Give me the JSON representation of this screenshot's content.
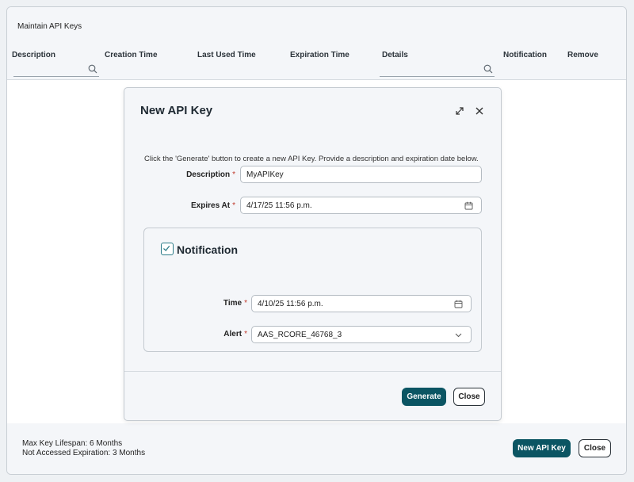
{
  "page": {
    "title": "Maintain API Keys",
    "columns": [
      "Description",
      "Creation Time",
      "Last Used Time",
      "Expiration Time",
      "Details",
      "Notification",
      "Remove"
    ]
  },
  "footer": {
    "max_lifespan": "Max Key Lifespan: 6 Months",
    "not_accessed": "Not Accessed Expiration: 3 Months",
    "new_key_button": "New API Key",
    "close_button": "Close"
  },
  "modal": {
    "title": "New API Key",
    "description_text": "Click the 'Generate' button to create a new API Key. Provide a description and expiration date below.",
    "fields": {
      "description": {
        "label": "Description",
        "required_mark": "*",
        "value": "MyAPIKey"
      },
      "expires_at": {
        "label": "Expires At",
        "required_mark": "*",
        "value": "4/17/25 11:56 p.m."
      }
    },
    "notification": {
      "label": "Notification",
      "checked": true,
      "time": {
        "label": "Time",
        "required_mark": "*",
        "value": "4/10/25 11:56 p.m."
      },
      "alert": {
        "label": "Alert",
        "required_mark": "*",
        "value": "AAS_RCORE_46768_3"
      }
    },
    "generate_button": "Generate",
    "close_button": "Close"
  },
  "colors": {
    "primary_button": "#0b5563",
    "checkbox_accent": "#2a7b88",
    "required": "#c0392b"
  },
  "icons": [
    "search-icon",
    "expand-icon",
    "close-icon",
    "calendar-icon",
    "chevron-down-icon",
    "checkmark-icon"
  ]
}
